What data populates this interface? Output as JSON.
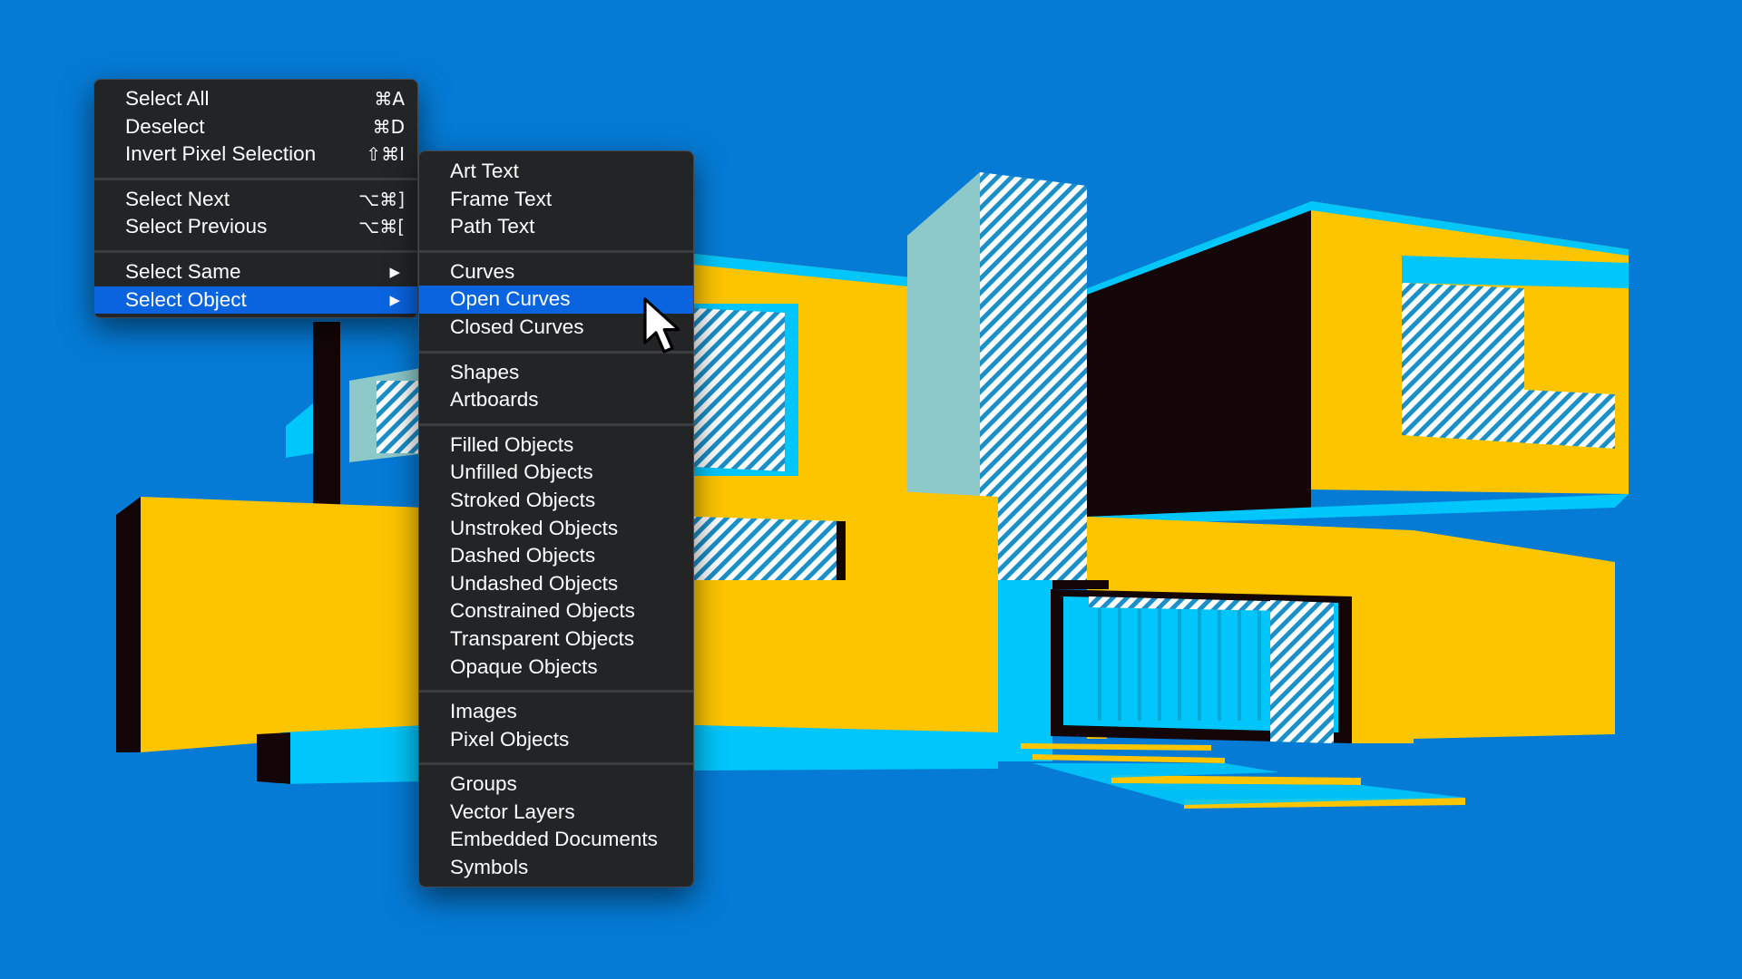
{
  "colors": {
    "background": "#057bd6",
    "yellow": "#fdc500",
    "cyan": "#00c6fb",
    "black": "#140606",
    "mint": "#8ec9c9",
    "menu_bg": "#222426",
    "highlight": "#0a63df"
  },
  "main_menu": {
    "groups": [
      [
        {
          "label": "Select All",
          "shortcut": "⌘A"
        },
        {
          "label": "Deselect",
          "shortcut": "⌘D"
        },
        {
          "label": "Invert Pixel Selection",
          "shortcut": "⇧⌘I"
        }
      ],
      [
        {
          "label": "Select Next",
          "shortcut": "⌥⌘]"
        },
        {
          "label": "Select Previous",
          "shortcut": "⌥⌘["
        }
      ],
      [
        {
          "label": "Select Same",
          "submenu_icon": "submenu-arrow-icon"
        },
        {
          "label": "Select Object",
          "submenu_icon": "submenu-arrow-icon",
          "selected": true
        }
      ]
    ]
  },
  "sub_menu": {
    "groups": [
      [
        "Art Text",
        "Frame Text",
        "Path Text"
      ],
      [
        "Curves",
        "Open Curves",
        "Closed Curves"
      ],
      [
        "Shapes",
        "Artboards"
      ],
      [
        "Filled Objects",
        "Unfilled Objects",
        "Stroked Objects",
        "Unstroked Objects",
        "Dashed Objects",
        "Undashed Objects",
        "Constrained Objects",
        "Transparent Objects",
        "Opaque Objects"
      ],
      [
        "Images",
        "Pixel Objects"
      ],
      [
        "Groups",
        "Vector Layers",
        "Embedded Documents",
        "Symbols"
      ]
    ],
    "hovered": "Open Curves"
  },
  "cursor_icon": "mouse-pointer-icon"
}
